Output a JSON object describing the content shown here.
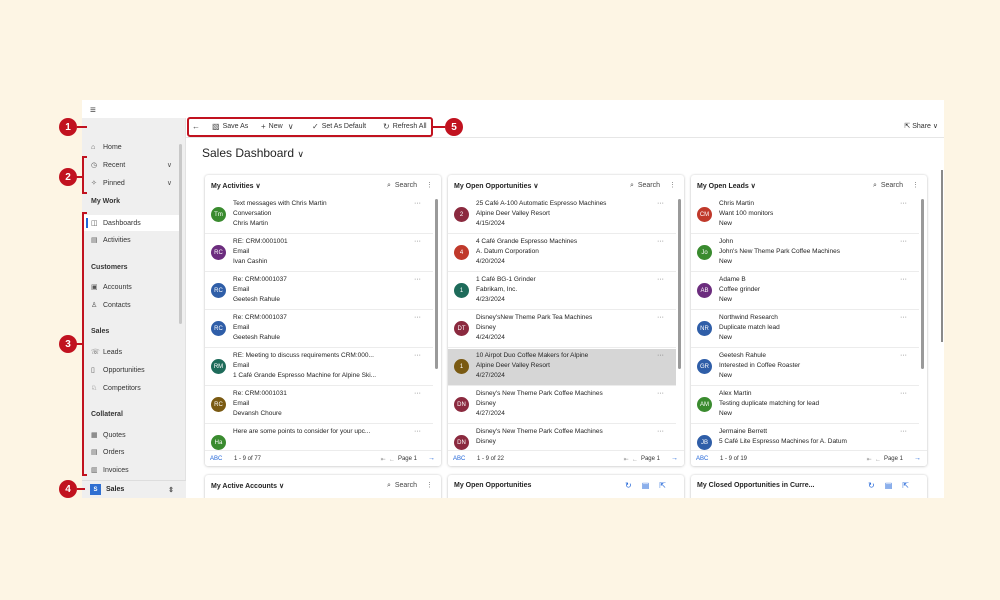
{
  "sidebar": {
    "home": "Home",
    "recent": "Recent",
    "pinned": "Pinned",
    "my_work_heading": "My Work",
    "dashboards": "Dashboards",
    "activities": "Activities",
    "customers_heading": "Customers",
    "accounts": "Accounts",
    "contacts": "Contacts",
    "sales_heading": "Sales",
    "leads": "Leads",
    "opportunities": "Opportunities",
    "competitors": "Competitors",
    "collateral_heading": "Collateral",
    "quotes": "Quotes",
    "orders": "Orders",
    "invoices": "Invoices",
    "area_initial": "S",
    "area_name": "Sales"
  },
  "toolbar": {
    "save_as": "Save As",
    "new": "New",
    "set_as_default": "Set As Default",
    "refresh_all": "Refresh All",
    "share": "Share"
  },
  "dashboard": {
    "title": "Sales Dashboard"
  },
  "cards": {
    "activities": {
      "title": "My Activities",
      "search": "Search",
      "rows": [
        {
          "initials": "Tm",
          "color": "#3a8b2f",
          "l1": "Text messages with Chris Martin",
          "l2": "Conversation",
          "l3": "Chris Martin"
        },
        {
          "initials": "RC",
          "color": "#6c2d7e",
          "l1": "RE: CRM:0001001",
          "l2": "Email",
          "l3": "Ivan Cashin"
        },
        {
          "initials": "RC",
          "color": "#2f5ea8",
          "l1": "Re: CRM:0001037",
          "l2": "Email",
          "l3": "Geetesh Rahule"
        },
        {
          "initials": "RC",
          "color": "#2f5ea8",
          "l1": "Re: CRM:0001037",
          "l2": "Email",
          "l3": "Geetesh Rahule"
        },
        {
          "initials": "RM",
          "color": "#1e6b5a",
          "l1": "RE: Meeting to discuss requirements CRM:000...",
          "l2": "Email",
          "l3": "1 Café Grande Espresso Machine for Alpine Ski..."
        },
        {
          "initials": "RC",
          "color": "#7a5a12",
          "l1": "Re: CRM:0001031",
          "l2": "Email",
          "l3": "Devansh Choure"
        },
        {
          "initials": "Ha",
          "color": "#3a8b2f",
          "l1": "Here are some points to consider for your upc...",
          "l2": "",
          "l3": ""
        }
      ],
      "count": "1 - 9 of 77",
      "abc": "ABC",
      "page": "Page 1"
    },
    "opportunities": {
      "title": "My Open Opportunities",
      "search": "Search",
      "rows": [
        {
          "initials": "2",
          "color": "#8b2a3f",
          "l1": "25 Café A-100 Automatic Espresso Machines",
          "l2": "Alpine Deer Valley Resort",
          "l3": "4/15/2024"
        },
        {
          "initials": "4",
          "color": "#c0392b",
          "l1": "4 Café Grande Espresso Machines",
          "l2": "A. Datum Corporation",
          "l3": "4/20/2024"
        },
        {
          "initials": "1",
          "color": "#1e6b5a",
          "l1": "1 Café BG-1 Grinder",
          "l2": "Fabrikam, Inc.",
          "l3": "4/23/2024"
        },
        {
          "initials": "DT",
          "color": "#8b2a3f",
          "l1": "Disney'sNew Theme Park Tea Machines",
          "l2": "Disney",
          "l3": "4/24/2024"
        },
        {
          "initials": "1",
          "color": "#7a5a12",
          "l1": "10 Airpot Duo Coffee Makers for Alpine",
          "l2": "Alpine Deer Valley Resort",
          "l3": "4/27/2024"
        },
        {
          "initials": "DN",
          "color": "#8b2a3f",
          "l1": "Disney's New Theme Park Coffee Machines",
          "l2": "Disney",
          "l3": "4/27/2024"
        },
        {
          "initials": "DN",
          "color": "#8b2a3f",
          "l1": "Disney's New Theme Park Coffee Machines",
          "l2": "Disney",
          "l3": ""
        }
      ],
      "count": "1 - 9 of 22",
      "abc": "ABC",
      "page": "Page 1"
    },
    "leads": {
      "title": "My Open Leads",
      "search": "Search",
      "rows": [
        {
          "initials": "CM",
          "color": "#c0392b",
          "l1": "Chris Martin",
          "l2": "Want 100 monitors",
          "l3": "New"
        },
        {
          "initials": "Jo",
          "color": "#3a8b2f",
          "l1": "John",
          "l2": "John's New Theme Park Coffee Machines",
          "l3": "New"
        },
        {
          "initials": "AB",
          "color": "#6c2d7e",
          "l1": "Adame B",
          "l2": "Coffee grinder",
          "l3": "New"
        },
        {
          "initials": "NR",
          "color": "#2f5ea8",
          "l1": "Northwind Research",
          "l2": "Duplicate match lead",
          "l3": "New"
        },
        {
          "initials": "GR",
          "color": "#2f5ea8",
          "l1": "Geetesh Rahule",
          "l2": "Interested in Coffee Roaster",
          "l3": "New"
        },
        {
          "initials": "AM",
          "color": "#3a8b2f",
          "l1": "Alex Martin",
          "l2": "Testing duplicate matching for lead",
          "l3": "New"
        },
        {
          "initials": "JB",
          "color": "#2f5ea8",
          "l1": "Jermaine Berrett",
          "l2": "5 Café Lite Espresso Machines for A. Datum",
          "l3": ""
        }
      ],
      "count": "1 - 9 of 19",
      "abc": "ABC",
      "page": "Page 1"
    },
    "accounts": {
      "title": "My Active Accounts",
      "search": "Search"
    },
    "open_opps_chart": {
      "title": "My Open Opportunities"
    },
    "closed_opps": {
      "title": "My Closed Opportunities in Curre..."
    }
  },
  "markers": {
    "m1": "1",
    "m2": "2",
    "m3": "3",
    "m4": "4",
    "m5": "5"
  },
  "colors": {
    "marker_red": "#c1121f",
    "accent_blue": "#2266d8"
  }
}
